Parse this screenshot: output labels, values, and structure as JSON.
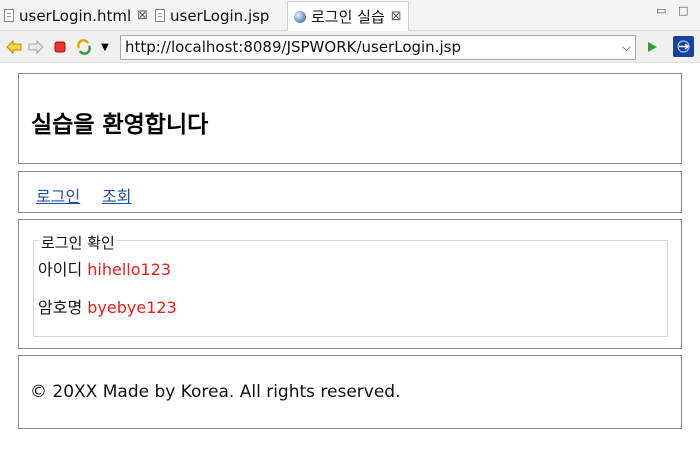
{
  "tabs": [
    {
      "label": "userLogin.html",
      "icon": "document-icon",
      "closable": true,
      "active": false
    },
    {
      "label": "userLogin.jsp",
      "icon": "document-icon",
      "closable": false,
      "active": false
    },
    {
      "label": "로그인 실습",
      "icon": "globe-icon",
      "closable": true,
      "active": true
    }
  ],
  "tab_close_glyph": "⊠",
  "window_controls": {
    "minimize": "▭",
    "maximize": "□"
  },
  "toolbar": {
    "back_icon": "arrow-left-icon",
    "forward_icon": "arrow-right-icon",
    "stop_icon": "stop-icon",
    "refresh_icon": "refresh-icon",
    "url": "http://localhost:8089/JSPWORK/userLogin.jsp",
    "go_icon": "play-icon",
    "colors": {
      "back": "#e8b000",
      "stop": "#d11a1a",
      "go": "#2aa52a",
      "external": "#1a3fa0"
    }
  },
  "page": {
    "title": "실습을 환영합니다",
    "nav": [
      "로그인",
      "조회"
    ],
    "fieldset_legend": "로그인 확인",
    "rows": [
      {
        "label": "아이디",
        "value": "hihello123"
      },
      {
        "label": "암호명",
        "value": "byebye123"
      }
    ],
    "footer": "© 20XX Made by Korea. All rights reserved.",
    "colors": {
      "link": "#1f4ea8",
      "value": "#e0201c",
      "border": "#8a8a8a"
    }
  }
}
